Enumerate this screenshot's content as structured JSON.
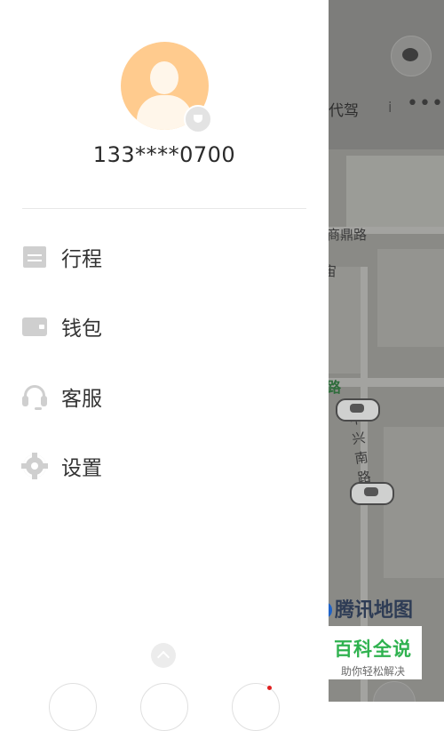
{
  "map": {
    "top_label": "代驾",
    "info_glyph": "i",
    "more_glyph": "•••",
    "street_labels": [
      "商鼎路",
      "宙",
      "路"
    ],
    "vertical_street": "中兴南路",
    "brand": "腾讯地图"
  },
  "drawer": {
    "phone": "133****0700",
    "menu": [
      {
        "label": "行程",
        "icon": "calendar-icon"
      },
      {
        "label": "钱包",
        "icon": "wallet-icon"
      },
      {
        "label": "客服",
        "icon": "headset-icon"
      },
      {
        "label": "设置",
        "icon": "gear-icon"
      }
    ]
  },
  "watermark": {
    "title": "百科全说",
    "subtitle": "助你轻松解决"
  },
  "colors": {
    "accent_green": "#2fb24f",
    "avatar_bg": "#ffcb8e",
    "notification_dot": "#e02020"
  }
}
